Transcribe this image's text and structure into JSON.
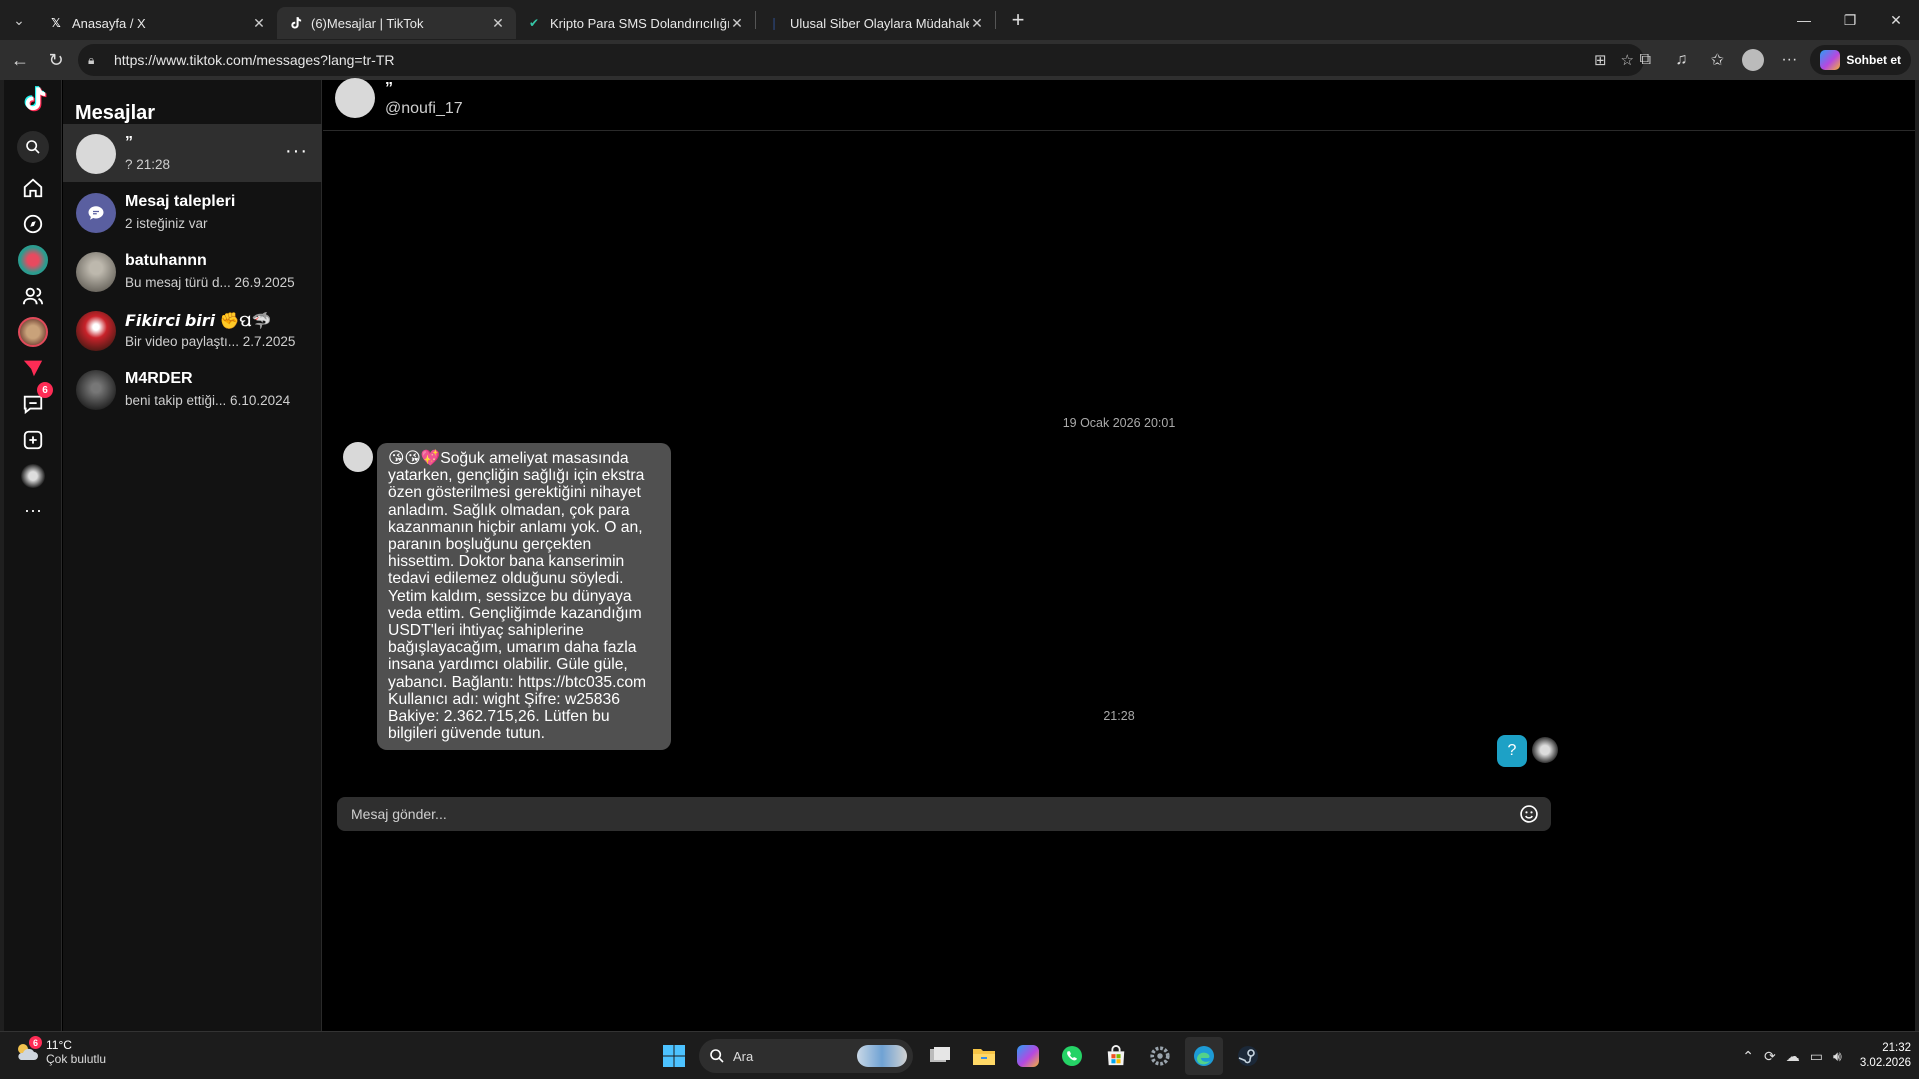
{
  "browser": {
    "tabs": [
      {
        "title": "Anasayfa / X",
        "favicon": "x-logo-icon",
        "active": false
      },
      {
        "title": "(6)Mesajlar | TikTok",
        "favicon": "tiktok-logo-icon",
        "active": true
      },
      {
        "title": "Kripto Para SMS Dolandırıcılığı Kri",
        "favicon": "site-check-icon",
        "active": false
      },
      {
        "title": "Ulusal Siber Olaylara Müdahale Me",
        "favicon": "site-icon",
        "active": false
      }
    ],
    "url": "https://www.tiktok.com/messages?lang=tr-TR",
    "copilot_label": "Sohbet et"
  },
  "sidebar_nav": {
    "items": [
      "tiktok-logo-icon",
      "search-icon",
      "home-icon",
      "explore-icon",
      "live-avatar-icon",
      "following-icon",
      "friends-avatar-icon",
      "activity-send-icon",
      "messages-icon",
      "upload-icon",
      "profile-avatar-icon",
      "more-icon"
    ],
    "messages_badge": "6"
  },
  "conversations": {
    "title": "Mesajlar",
    "items": [
      {
        "name": "”",
        "preview": "? 21:28"
      },
      {
        "name": "Mesaj talepleri",
        "preview": "2 isteğiniz var"
      },
      {
        "name": "batuhannn",
        "preview": "Bu mesaj türü d...  26.9.2025"
      },
      {
        "name": "𝙁𝙞𝙠𝙞𝙧𝙘𝙞 𝙗𝙞𝙧𝙞 ✊ପ🦈",
        "preview": "Bir video paylaştı...  2.7.2025"
      },
      {
        "name": "M4RDER",
        "preview": "beni takip ettiği...  6.10.2024"
      }
    ]
  },
  "chat": {
    "name": "”",
    "handle": "@noufi_17",
    "date_stamp": "19 Ocak 2026 20:01",
    "message": "😘😘💖Soğuk ameliyat masasında yatarken, gençliğin sağlığı için ekstra özen gösterilmesi gerektiğini nihayet anladım. Sağlık olmadan, çok para kazanmanın hiçbir anlamı yok. O an, paranın boşluğunu gerçekten hissettim. Doktor bana kanserimin tedavi edilemez olduğunu söyledi. Yetim kaldım, sessizce bu dünyaya veda ettim. Gençliğimde kazandığım USDT'leri ihtiyaç sahiplerine bağışlayacağım, umarım daha fazla insana yardımcı olabilir. Güle güle, yabancı. Bağlantı: https://btc035.com  Kullanıcı adı: wight Şifre: w25836  Bakiye: 2.362.715,26. Lütfen bu bilgileri güvende tutun.",
    "reply_time": "21:28",
    "reply_text": "?",
    "input_placeholder": "Mesaj gönder..."
  },
  "taskbar": {
    "weather_temp": "11°C",
    "weather_desc": "Çok bulutlu",
    "weather_badge": "6",
    "search_label": "Ara",
    "time": "21:32",
    "date": "3.02.2026"
  },
  "colors": {
    "accent_red": "#fe2c55",
    "reply_bubble": "#1da1c6",
    "received_bubble": "#505050"
  }
}
